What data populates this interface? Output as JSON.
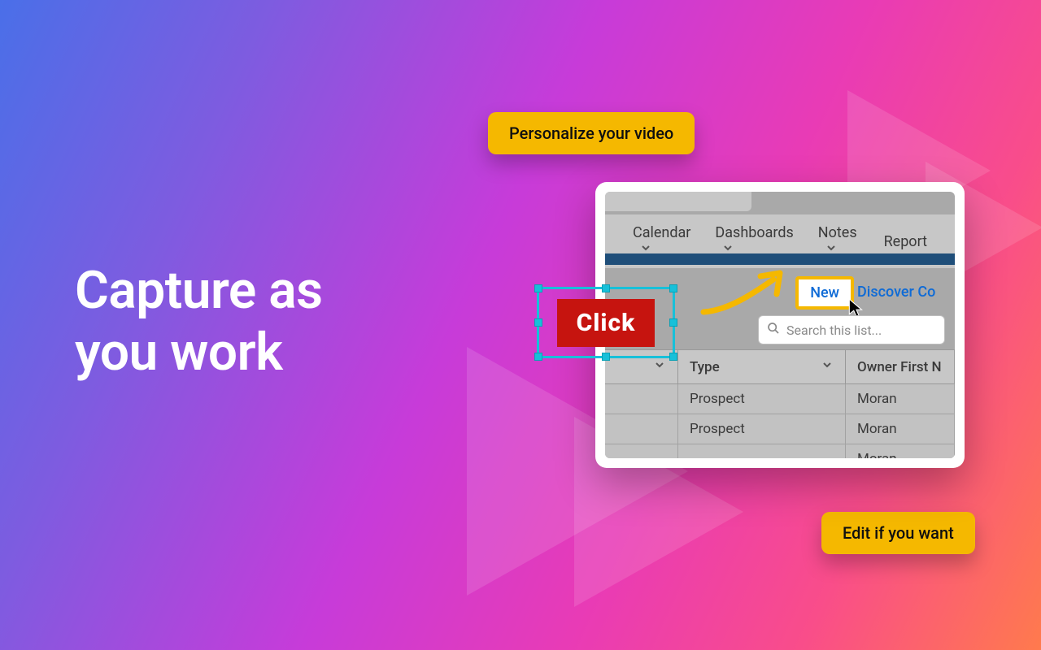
{
  "headline": {
    "line1": "Capture as",
    "line2": "you work"
  },
  "pills": {
    "top": "Personalize your video",
    "bottom": "Edit if you want"
  },
  "annotation": {
    "click_label": "Click"
  },
  "app": {
    "nav": {
      "calendar": "Calendar",
      "dashboards": "Dashboards",
      "notes": "Notes",
      "reports": "Report"
    },
    "buttons": {
      "new": "New",
      "discover": "Discover Co"
    },
    "search_placeholder": "Search this list...",
    "table": {
      "headers": {
        "type": "Type",
        "owner_first": "Owner First N"
      },
      "rows": [
        {
          "type": "Prospect",
          "owner_first": "Moran"
        },
        {
          "type": "Prospect",
          "owner_first": "Moran"
        },
        {
          "type": "",
          "owner_first": "Moran"
        }
      ]
    }
  },
  "colors": {
    "accent": "#f5b800",
    "cyan": "#17c0d9",
    "red": "#c6140f",
    "link": "#0f6bd6"
  }
}
